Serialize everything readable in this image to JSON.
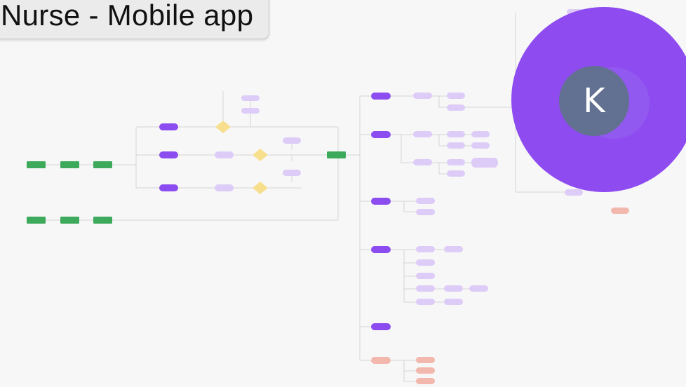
{
  "frame": {
    "title": "Nurse - Mobile app"
  },
  "user": {
    "avatar_letter": "K"
  },
  "colors": {
    "canvas_bg": "#f7f7f7",
    "start_node": "#3daa5b",
    "screen_node": "#8b4cf0",
    "sub_node": "#ddccf7",
    "decision_node": "#f7df8d",
    "error_node": "#f3b8ad",
    "avatar_bg": "#8e4cf0",
    "avatar_face": "#627091"
  },
  "flow": {
    "node_kinds": [
      "start",
      "screen",
      "subscreen",
      "decision",
      "error"
    ]
  }
}
